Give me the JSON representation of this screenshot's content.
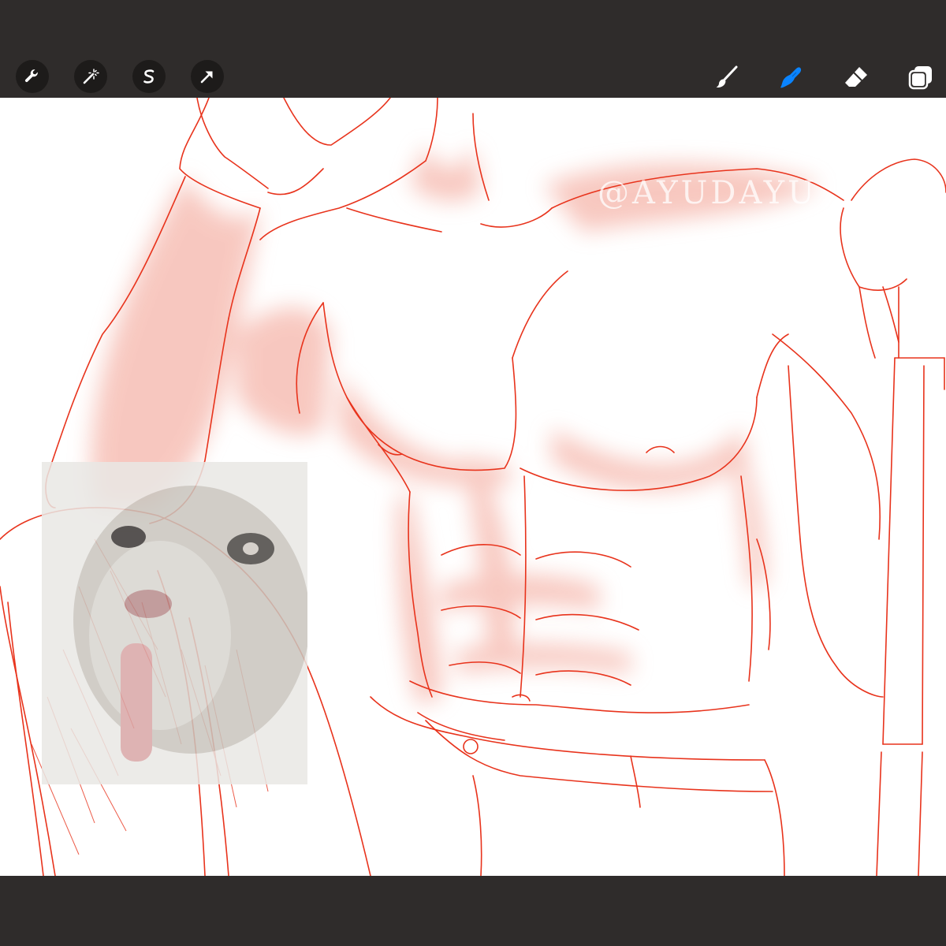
{
  "toolbar": {
    "left_tools": [
      {
        "name": "actions",
        "icon": "wrench-icon"
      },
      {
        "name": "adjustments",
        "icon": "magic-wand-icon"
      },
      {
        "name": "selection",
        "icon": "selection-s-icon"
      },
      {
        "name": "transform",
        "icon": "arrow-cursor-icon"
      }
    ],
    "right_tools": [
      {
        "name": "brush",
        "icon": "paintbrush-icon",
        "active": false
      },
      {
        "name": "smudge",
        "icon": "smudge-finger-icon",
        "active": true
      },
      {
        "name": "eraser",
        "icon": "eraser-icon",
        "active": false
      },
      {
        "name": "layers",
        "icon": "layers-icon",
        "active": false
      }
    ],
    "active_color": "#0a84ff",
    "icon_color": "#ffffff",
    "bar_color": "#2f2c2b"
  },
  "canvas": {
    "background": "#ffffff",
    "line_color": "#e8331c",
    "shade_color": "#f4a99a",
    "watermark": "@AYUDAYU"
  },
  "reference": {
    "description_icon": "cat-photo-icon"
  }
}
